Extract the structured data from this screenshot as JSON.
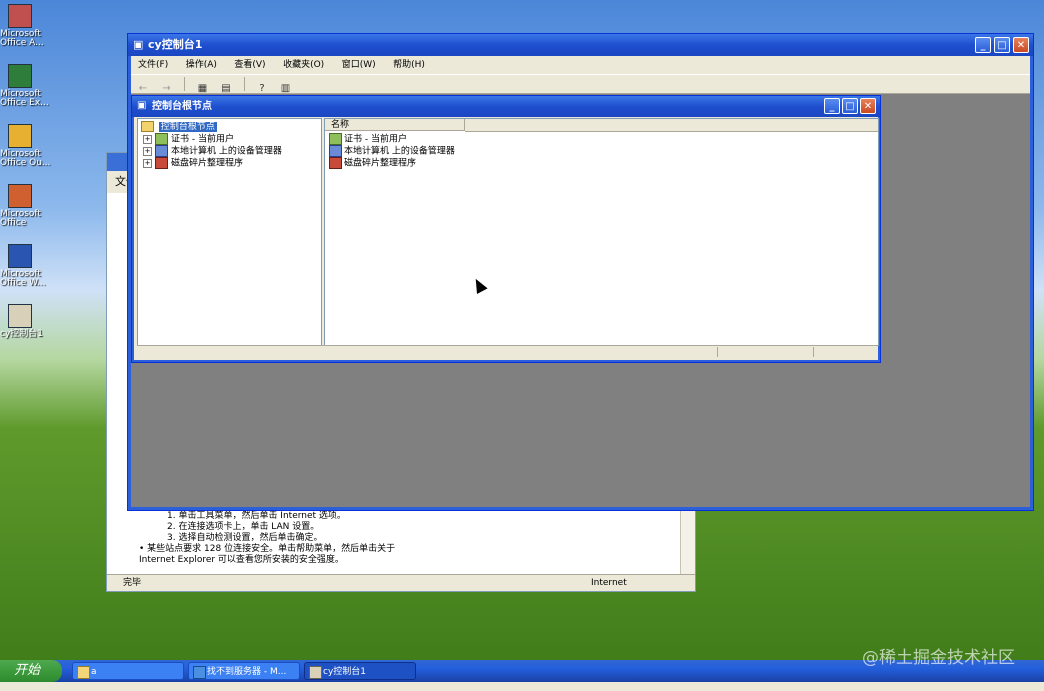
{
  "desktop": {
    "icons": [
      {
        "label": "Microsoft\nOffice A..."
      },
      {
        "label": "Microsoft\nOffice Ex..."
      },
      {
        "label": "Microsoft\nOffice Ou..."
      },
      {
        "label": "Microsoft\nOffice"
      },
      {
        "label": "Microsoft\nOffice W..."
      },
      {
        "label": "cy控制台1"
      }
    ]
  },
  "ie_window": {
    "menu_first": "文件",
    "content_lines": [
      "1.  单击工具菜单，然后单击 Internet 选项。",
      "2.  在连接选项卡上，单击 LAN 设置。",
      "3.  选择自动检测设置，然后单击确定。",
      "• 某些站点要求 128 位连接安全。单击帮助菜单，然后单击关于",
      "  Internet Explorer 可以查看您所安装的安全强度。"
    ],
    "status_left": "完毕",
    "status_right": "Internet"
  },
  "mmc_window": {
    "title": "cy控制台1",
    "menu": [
      "文件(F)",
      "操作(A)",
      "查看(V)",
      "收藏夹(O)",
      "窗口(W)",
      "帮助(H)"
    ],
    "toolbar_icons": [
      "back-icon",
      "forward-icon",
      "show-tree-icon",
      "export-icon",
      "help-icon",
      "properties-icon"
    ]
  },
  "child_window": {
    "title": "控制台根节点",
    "tree": {
      "root": "控制台根节点",
      "items": [
        "证书 - 当前用户",
        "本地计算机 上的设备管理器",
        "磁盘碎片整理程序"
      ]
    },
    "list": {
      "header": "名称",
      "items": [
        "证书 - 当前用户",
        "本地计算机 上的设备管理器",
        "磁盘碎片整理程序"
      ]
    }
  },
  "taskbar": {
    "start_label": "开始",
    "buttons": [
      {
        "label": "a"
      },
      {
        "label": "找不到服务器 - M..."
      },
      {
        "label": "cy控制台1"
      }
    ]
  },
  "watermark": "@稀土掘金技术社区",
  "colors": {
    "title_bar": "#245edb",
    "selection": "#316ac5",
    "start": "#3c9a3c",
    "mdi_background": "#808080"
  }
}
